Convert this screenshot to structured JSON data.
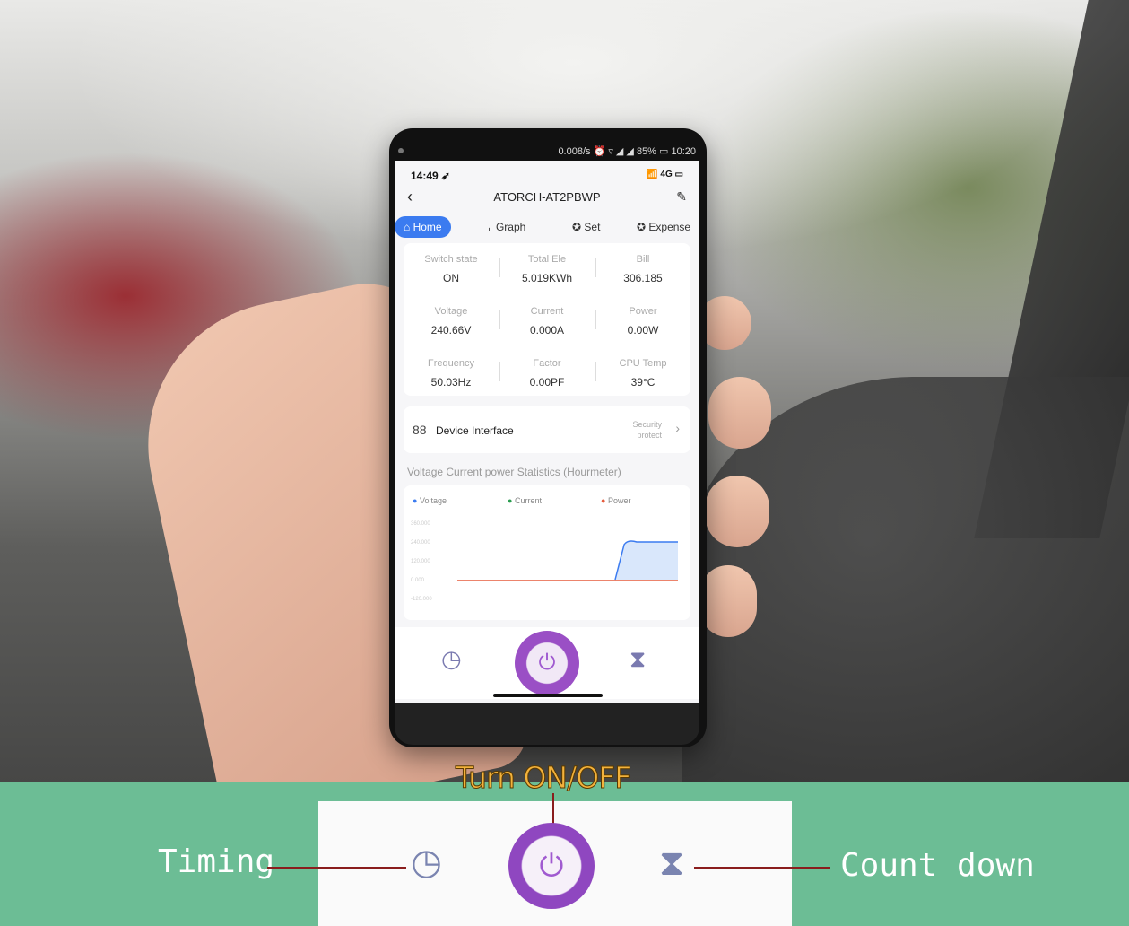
{
  "status_bar": {
    "android": "0.008/s ⏰ ▿ ◢ ◢ 85% ▭ 10:20",
    "ios_time": "14:49 ➶",
    "ios_right": "📶 4G ▭"
  },
  "app": {
    "title": "ATORCH-AT2PBWP",
    "back": "‹",
    "edit": "✎"
  },
  "tabs": [
    {
      "icon": "⌂",
      "label": "Home"
    },
    {
      "icon": "⌞",
      "label": "Graph"
    },
    {
      "icon": "✪",
      "label": "Set"
    },
    {
      "icon": "✪",
      "label": "Expense"
    }
  ],
  "metrics": [
    {
      "label": "Switch state",
      "value": "ON"
    },
    {
      "label": "Total Ele",
      "value": "5.019KWh"
    },
    {
      "label": "Bill",
      "value": "306.185"
    },
    {
      "label": "Voltage",
      "value": "240.66V"
    },
    {
      "label": "Current",
      "value": "0.000A"
    },
    {
      "label": "Power",
      "value": "0.00W"
    },
    {
      "label": "Frequency",
      "value": "50.03Hz"
    },
    {
      "label": "Factor",
      "value": "0.00PF"
    },
    {
      "label": "CPU Temp",
      "value": "39°C"
    }
  ],
  "device": {
    "icon": "88",
    "label": "Device Interface",
    "security": "Security protect",
    "chevron": "›"
  },
  "stats_title": "Voltage Current power Statistics (Hourmeter)",
  "chart_legend": [
    "Voltage",
    "Current",
    "Power"
  ],
  "chart_ticks": [
    "360.000",
    "240.000",
    "120.000",
    "0.000",
    "-120.000"
  ],
  "controls": {
    "timer_icon": "◷",
    "power_icon": "⏻",
    "count_icon": "⧗"
  },
  "labels": {
    "turn": "Turn ON/OFF",
    "timing": "Timing",
    "count": "Count down"
  },
  "colors": {
    "green_band": "#6cbd95",
    "accent": "#3b7bf0",
    "power": "#9a4fc5",
    "voltage": "#3b7bf0",
    "current": "#2a9d4f",
    "power_series": "#e55b3c"
  }
}
